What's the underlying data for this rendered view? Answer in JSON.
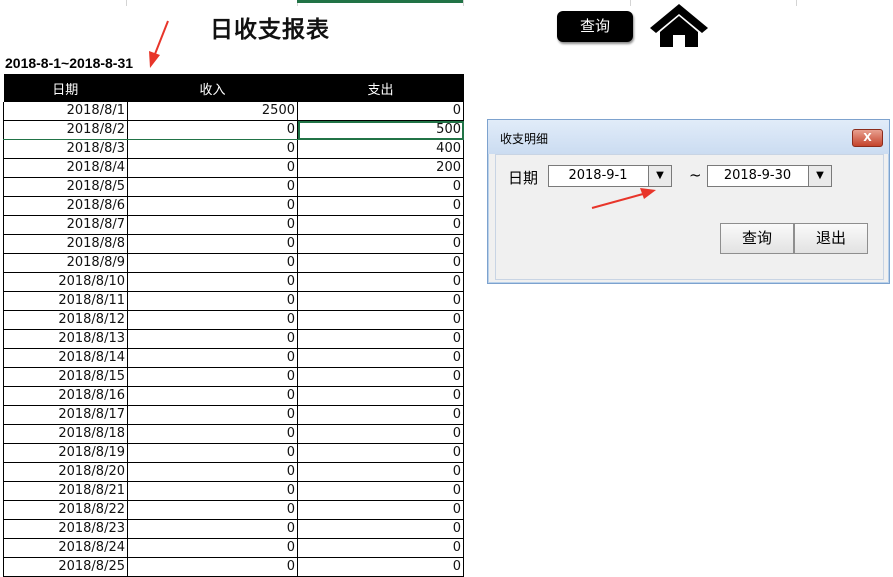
{
  "header": {
    "title": "日收支报表",
    "query_button": "查询",
    "date_range": "2018-8-1~2018-8-31"
  },
  "table": {
    "columns": [
      "日期",
      "收入",
      "支出"
    ],
    "rows": [
      [
        "2018/8/1",
        "2500",
        "0"
      ],
      [
        "2018/8/2",
        "0",
        "500"
      ],
      [
        "2018/8/3",
        "0",
        "400"
      ],
      [
        "2018/8/4",
        "0",
        "200"
      ],
      [
        "2018/8/5",
        "0",
        "0"
      ],
      [
        "2018/8/6",
        "0",
        "0"
      ],
      [
        "2018/8/7",
        "0",
        "0"
      ],
      [
        "2018/8/8",
        "0",
        "0"
      ],
      [
        "2018/8/9",
        "0",
        "0"
      ],
      [
        "2018/8/10",
        "0",
        "0"
      ],
      [
        "2018/8/11",
        "0",
        "0"
      ],
      [
        "2018/8/12",
        "0",
        "0"
      ],
      [
        "2018/8/13",
        "0",
        "0"
      ],
      [
        "2018/8/14",
        "0",
        "0"
      ],
      [
        "2018/8/15",
        "0",
        "0"
      ],
      [
        "2018/8/16",
        "0",
        "0"
      ],
      [
        "2018/8/17",
        "0",
        "0"
      ],
      [
        "2018/8/18",
        "0",
        "0"
      ],
      [
        "2018/8/19",
        "0",
        "0"
      ],
      [
        "2018/8/20",
        "0",
        "0"
      ],
      [
        "2018/8/21",
        "0",
        "0"
      ],
      [
        "2018/8/22",
        "0",
        "0"
      ],
      [
        "2018/8/23",
        "0",
        "0"
      ],
      [
        "2018/8/24",
        "0",
        "0"
      ],
      [
        "2018/8/25",
        "0",
        "0"
      ]
    ]
  },
  "dialog": {
    "title": "收支明细",
    "close_label": "X",
    "date_label": "日期",
    "start_date": "2018-9-1",
    "end_date": "2018-9-30",
    "separator": "~",
    "dropdown_arrow": "▼",
    "query_button": "查询",
    "exit_button": "退出"
  },
  "icons": {
    "home": "home-icon",
    "annotation": "red-arrow-icon",
    "close": "close-icon",
    "dropdown": "chevron-down-icon"
  },
  "colors": {
    "header_bg": "#000000",
    "selection": "#217346",
    "annotation": "#e8352a",
    "dialog_border": "#7da2ce"
  }
}
